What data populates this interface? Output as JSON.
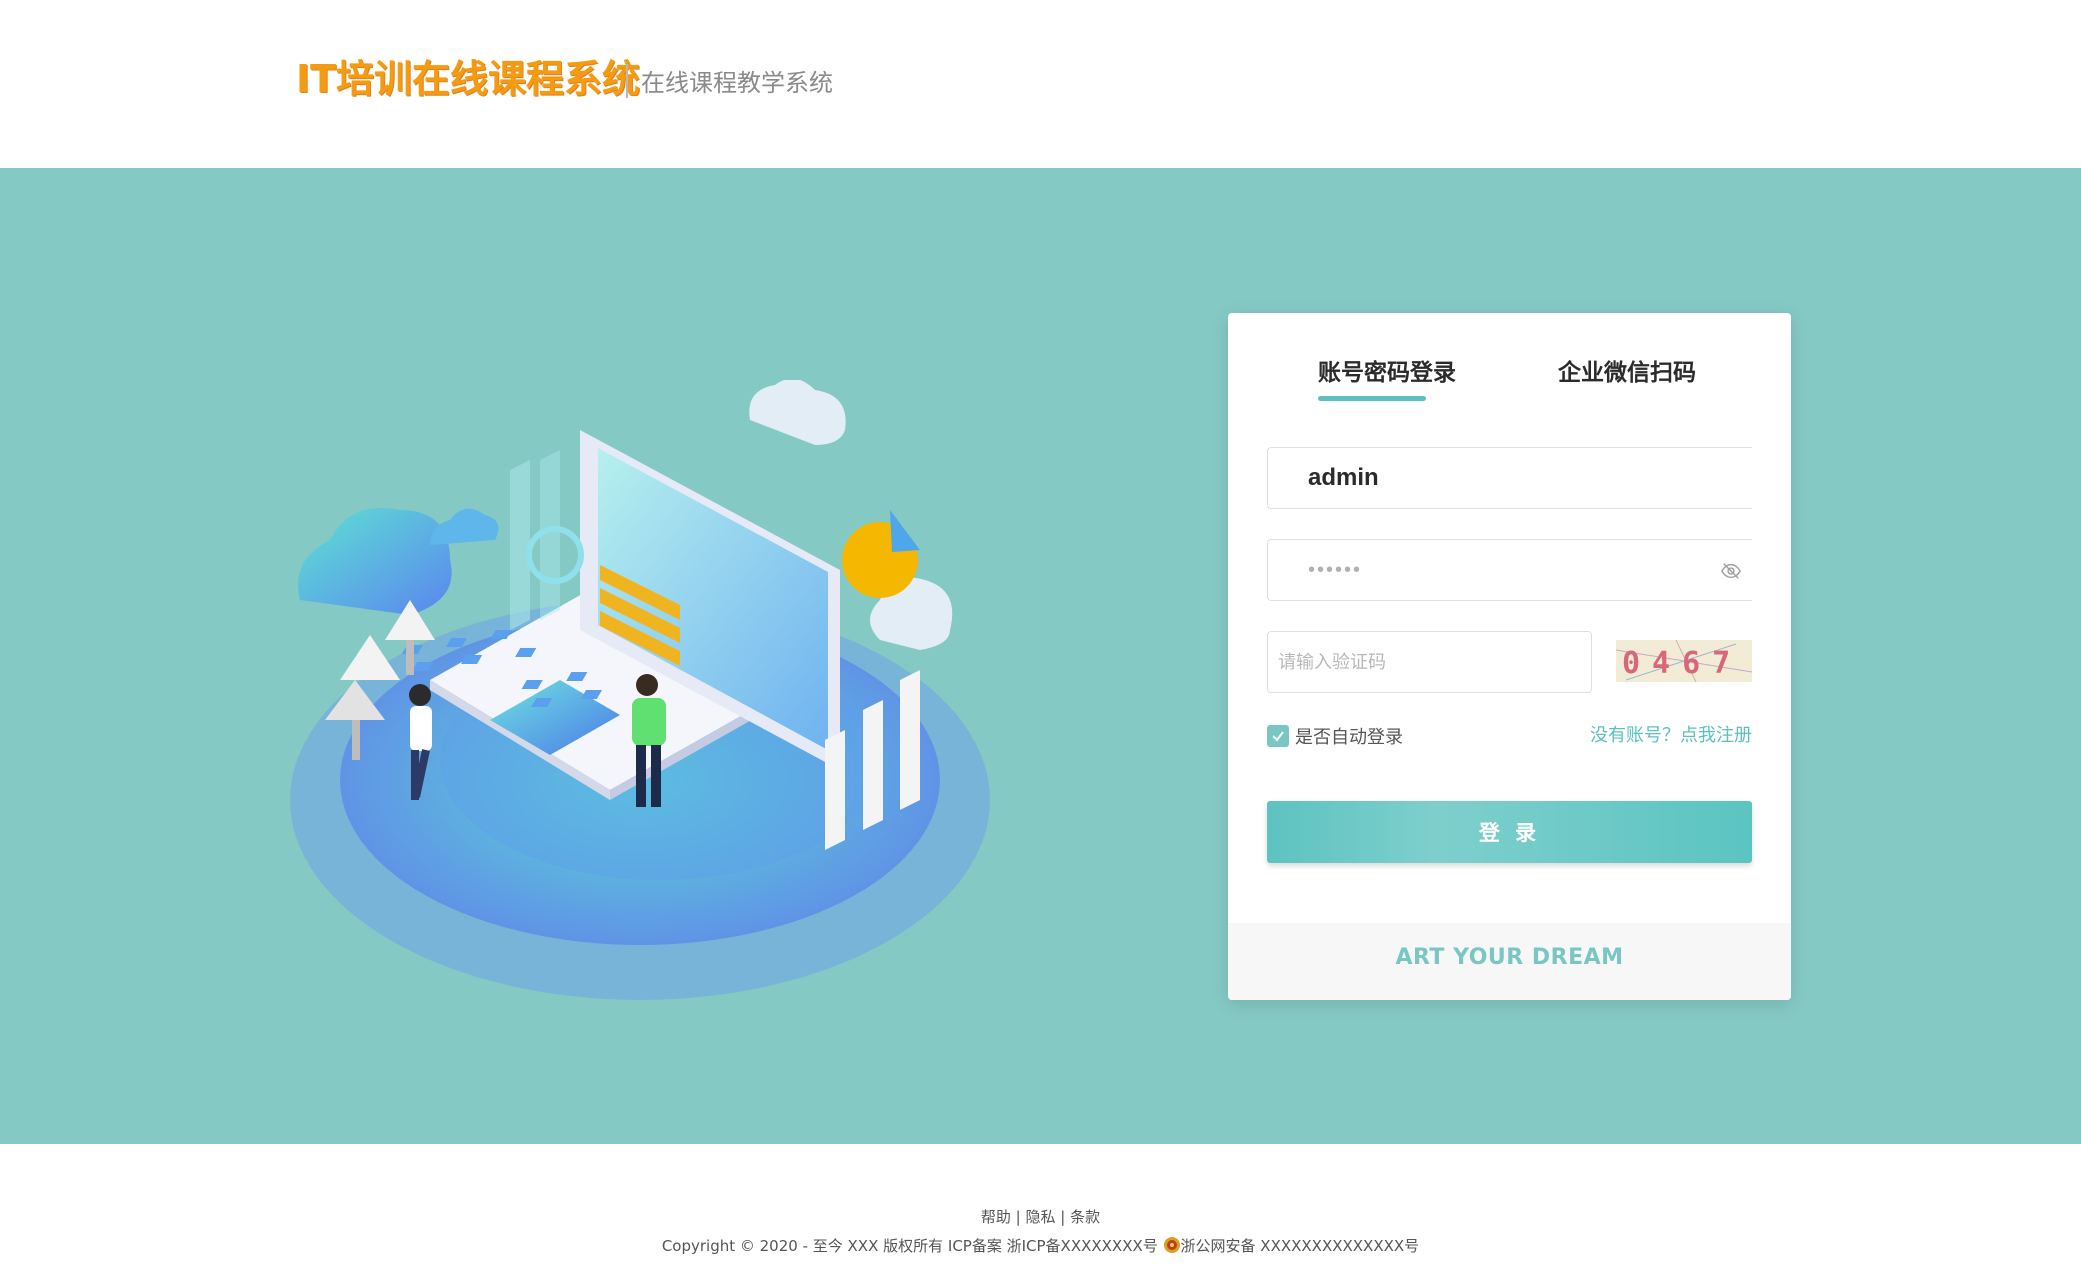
{
  "header": {
    "logo_title": "IT培训在线课程系统",
    "logo_subtitle": "在线课程教学系统"
  },
  "login": {
    "tabs": [
      {
        "label": "账号密码登录",
        "active": true
      },
      {
        "label": "企业微信扫码",
        "active": false
      }
    ],
    "username_value": "admin",
    "password_value": "••••••",
    "captcha_placeholder": "请输入验证码",
    "captcha_text": "0467",
    "remember_label": "是否自动登录",
    "remember_checked": true,
    "register_link": "没有账号？点我注册",
    "login_button": "登 录",
    "slogan": "ART YOUR DREAM"
  },
  "footer": {
    "links": [
      "帮助",
      "隐私",
      "条款"
    ],
    "separator": " | ",
    "copyright_prefix": "Copyright © 2020 - 至今 XXX 版权所有 ICP备案 浙ICP备XXXXXXXX号 ",
    "police_record": "浙公网安备 XXXXXXXXXXXXXX号"
  },
  "colors": {
    "band": "#85c9c5",
    "accent": "#5bc0be",
    "logo": "#f39c12"
  },
  "icons": {
    "password_toggle": "eye-off-icon",
    "checkbox": "check-icon",
    "police": "police-badge-icon"
  }
}
